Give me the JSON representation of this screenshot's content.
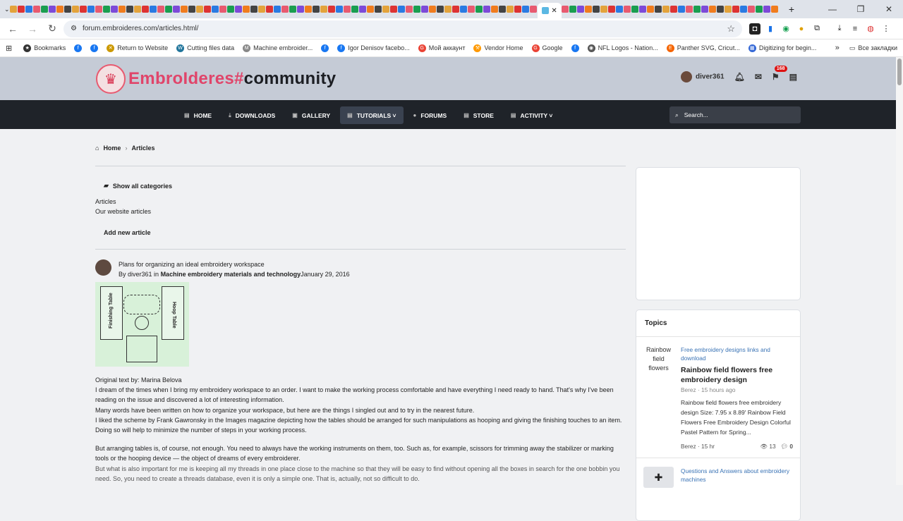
{
  "browser": {
    "url": "forum.embroideres.com/articles.html/",
    "all_bookmarks": "Все закладки",
    "bookmarks": [
      {
        "label": "Bookmarks",
        "icon": "star-icon"
      },
      {
        "label": "",
        "icon": "facebook-icon"
      },
      {
        "label": "",
        "icon": "facebook-icon"
      },
      {
        "label": "Return to Website",
        "icon": "site-icon"
      },
      {
        "label": "Cutting files data",
        "icon": "wordpress-icon"
      },
      {
        "label": "Machine embroider...",
        "icon": "m-icon"
      },
      {
        "label": "",
        "icon": "facebook-icon"
      },
      {
        "label": "Igor Denisov facebo...",
        "icon": "facebook-icon"
      },
      {
        "label": "Мой аккаунт",
        "icon": "google-icon"
      },
      {
        "label": "Vendor Home",
        "icon": "vendor-icon"
      },
      {
        "label": "Google",
        "icon": "google-icon"
      },
      {
        "label": "",
        "icon": "facebook-icon"
      },
      {
        "label": "NFL Logos - Nation...",
        "icon": "nfl-icon"
      },
      {
        "label": "Panther SVG, Cricut...",
        "icon": "etsy-icon"
      },
      {
        "label": "Digitizing for begin...",
        "icon": "doc-icon"
      }
    ]
  },
  "site": {
    "logo_a": "EmbroIderes#",
    "logo_b": "community",
    "username": "diver361",
    "notif_count": "168",
    "nav": [
      {
        "label": "HOME",
        "active": false
      },
      {
        "label": "DOWNLOADS",
        "active": false
      },
      {
        "label": "GALLERY",
        "active": false
      },
      {
        "label": "TUTORIALS ˅",
        "active": true
      },
      {
        "label": "FORUMS",
        "active": false
      },
      {
        "label": "STORE",
        "active": false
      },
      {
        "label": "ACTIVITY ˅",
        "active": false
      }
    ],
    "search_placeholder": "Search..."
  },
  "breadcrumb": {
    "home": "Home",
    "current": "Articles"
  },
  "categories": {
    "show_all": "Show all categories",
    "items": [
      "Articles",
      "Our website articles"
    ],
    "add_new": "Add new article"
  },
  "article": {
    "title": "Plans for organizing an ideal embroidery workspace",
    "by": "By ",
    "author": "diver361",
    "in": " in ",
    "category": "Machine embroidery materials and technology",
    "date": "January 29, 2016",
    "image_labels": {
      "left": "Finishing Table",
      "right": "Hoop Table"
    },
    "paragraphs": [
      "Original text by: Marina Belova",
      "I dream of the times when I bring my embroidery workspace to an order. I want to make the working process comfortable and have everything I need ready to hand. That's why I've been reading on the issue and discovered a lot of interesting information.",
      "Many words have been written on how to organize your workspace, but here are the things I singled out and to try in the  nearest future.",
      "I liked the scheme by Frank Gawronsky in the Images magazine depicting how the tables should be arranged for such manipulations as hooping and giving the finishing touches to an item. Doing so will help to minimize the number of steps in your working process.",
      "But arranging tables is, of course, not enough. You need to always have the working instruments on them, too. Such as, for example, scissors for trimming away the stabilizer or marking tools or the hooping device — the object of dreams of every embroiderer.",
      "But what is also important for me is keeping all my threads in one place close to the machine so that they will be easy to find without opening all the boxes in search for the one bobbin you need. So, you need to create a threads database, even it is only a simple one. That is, actually, not so difficult to do."
    ]
  },
  "sidebar": {
    "topics_title": "Topics",
    "topics": [
      {
        "img_alt": "Rainbow field flowers",
        "category": "Free embroidery designs links and download",
        "title": "Rainbow field flowers free embroidery design",
        "meta": "Berez · 15 hours ago",
        "desc": "Rainbow field flowers free embroidery design Size: 7.95 x 8.89' Rainbow Field Flowers Free Embroidery Design Colorful Pastel Pattern for Spring...",
        "foot_author": "Berez · 15 hr",
        "views": "13",
        "comments": "0"
      },
      {
        "category": "Questions and Answers about embroidery machines"
      }
    ]
  }
}
